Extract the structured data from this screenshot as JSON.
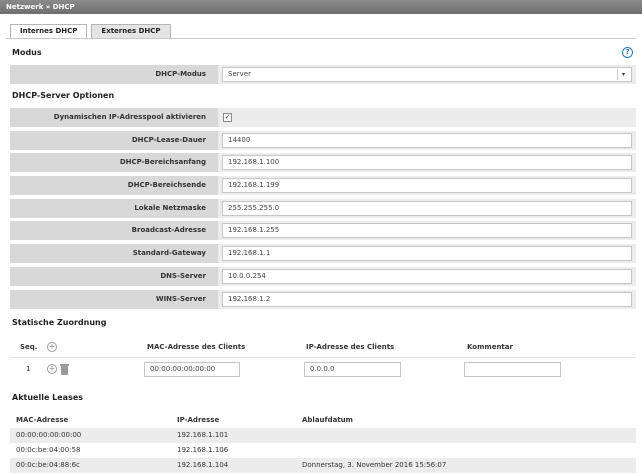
{
  "breadcrumb": "Netzwerk » DHCP",
  "tabs": [
    {
      "label": "Internes DHCP",
      "active": true
    },
    {
      "label": "Externes DHCP",
      "active": false
    }
  ],
  "modus": {
    "heading": "Modus",
    "label": "DHCP-Modus",
    "value": "Server",
    "help_icon": "question-circle-icon"
  },
  "server_options": {
    "heading": "DHCP-Server Optionen",
    "pool_label": "Dynamischen IP-Adresspool aktivieren",
    "pool_checked": true,
    "fields": [
      {
        "label": "DHCP-Lease-Dauer",
        "value": "14400"
      },
      {
        "label": "DHCP-Bereichsanfang",
        "value": "192.168.1.100"
      },
      {
        "label": "DHCP-Bereichsende",
        "value": "192.168.1.199"
      },
      {
        "label": "Lokale Netzmaske",
        "value": "255.255.255.0"
      },
      {
        "label": "Broadcast-Adresse",
        "value": "192.168.1.255"
      },
      {
        "label": "Standard-Gateway",
        "value": "192.168.1.1"
      },
      {
        "label": "DNS-Server",
        "value": "10.0.0.254"
      },
      {
        "label": "WINS-Server",
        "value": "192.168.1.2"
      }
    ]
  },
  "static": {
    "heading": "Statische Zuordnung",
    "columns": {
      "seq": "Seq.",
      "mac": "MAC-Adresse des Clients",
      "ip": "IP-Adresse des Clients",
      "comment": "Kommentar"
    },
    "rows": [
      {
        "seq": "1",
        "mac": "00:00:00:00:00:00",
        "ip": "0.0.0.0",
        "comment": ""
      }
    ]
  },
  "leases": {
    "heading": "Aktuelle Leases",
    "columns": {
      "mac": "MAC-Adresse",
      "ip": "IP-Adresse",
      "expiry": "Ablaufdatum"
    },
    "rows": [
      {
        "mac": "00:00:00:00:00:00",
        "ip": "192.168.1.101",
        "expiry": ""
      },
      {
        "mac": "00:0c:be:04:00:58",
        "ip": "192.168.1.106",
        "expiry": ""
      },
      {
        "mac": "00:0c:be:04:88:6c",
        "ip": "192.168.1.104",
        "expiry": "Donnerstag, 3. November 2016 15:56:07"
      }
    ]
  }
}
